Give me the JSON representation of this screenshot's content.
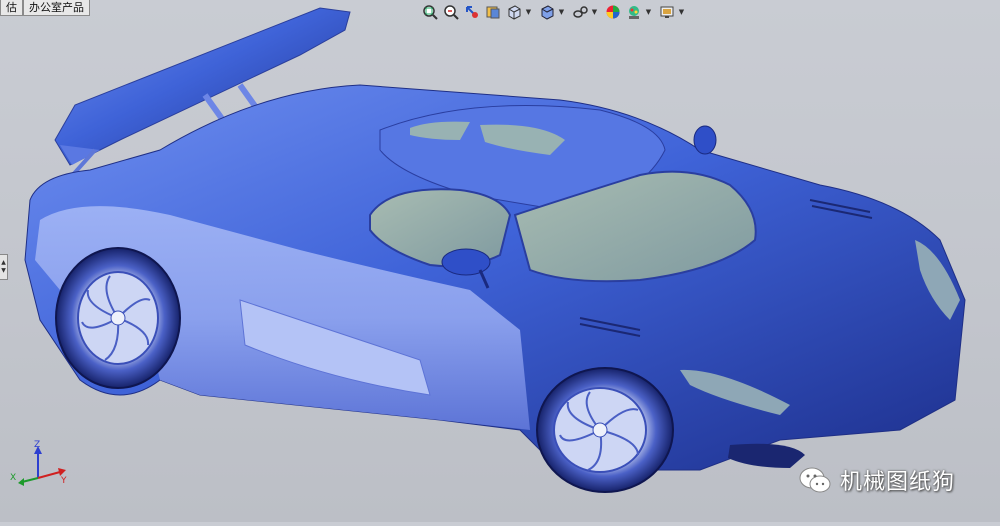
{
  "tabs": [
    {
      "label": "估"
    },
    {
      "label": "办公室产品"
    }
  ],
  "toolbar": {
    "icons": [
      "zoom-to-fit-icon",
      "zoom-to-area-icon",
      "previous-view-icon",
      "section-view-icon",
      "view-orientation-icon",
      "display-style-icon",
      "hide-show-items-icon",
      "edit-appearance-icon",
      "apply-scene-icon",
      "view-settings-icon"
    ]
  },
  "model": {
    "body_color": "#3f63d8",
    "glass_color": "#9db3a8"
  },
  "triad": {
    "x_label": "X",
    "y_label": "Y",
    "z_label": "Z"
  },
  "watermark": {
    "text": "机械图纸狗"
  }
}
